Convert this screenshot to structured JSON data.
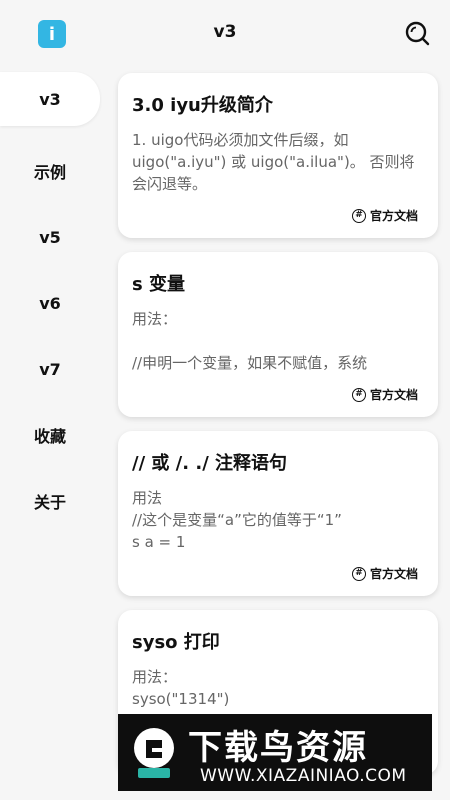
{
  "header": {
    "title": "v3",
    "app_icon_char": "i",
    "search_icon": "search-icon"
  },
  "sidebar": {
    "items": [
      {
        "label": "v3",
        "active": true
      },
      {
        "label": "示例"
      },
      {
        "label": "v5"
      },
      {
        "label": "v6"
      },
      {
        "label": "v7"
      },
      {
        "label": "收藏"
      },
      {
        "label": "关于"
      }
    ]
  },
  "cards": [
    {
      "title": "3.0 iyu升级简介",
      "body": "1. uigo代码必须加文件后缀，如 uigo(\"a.iyu\") 或 uigo(\"a.ilua\")。 否则将会闪退等。",
      "link": "官方文档"
    },
    {
      "title": "s 变量",
      "body": "用法：\n\n//申明一个变量，如果不赋值，系统",
      "link": "官方文档"
    },
    {
      "title": "// 或 /. ./ 注释语句",
      "body": "用法\n//这个是变量“a”它的值等于“1”\ns a = 1",
      "link": "官方文档"
    },
    {
      "title": "syso 打印",
      "body": "用法：\nsyso(\"1314\")",
      "link": ""
    }
  ],
  "banner": {
    "title": "下载鸟资源",
    "url": "WWW.XIAZAINIAO.COM"
  },
  "colors": {
    "accent": "#33b6e3",
    "background": "#f6f6f6",
    "card": "#ffffff"
  }
}
